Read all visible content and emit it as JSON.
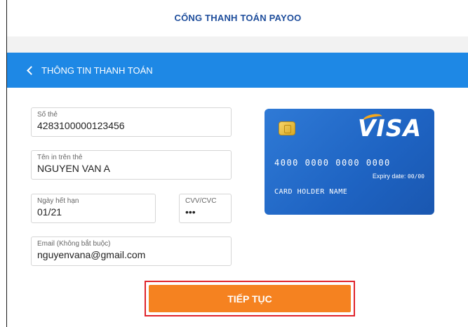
{
  "header": {
    "title": "CỔNG THANH TOÁN PAYOO"
  },
  "bar": {
    "back_label": "THÔNG TIN THANH TOÁN"
  },
  "form": {
    "card_number": {
      "label": "Số thẻ",
      "value": "4283100000123456"
    },
    "card_name": {
      "label": "Tên in trên thẻ",
      "value": "NGUYEN VAN A"
    },
    "expiry": {
      "label": "Ngày hết hạn",
      "value": "01/21"
    },
    "cvv": {
      "label": "CVV/CVC",
      "value": "•••"
    },
    "email": {
      "label": "Email (Không bắt buộc)",
      "value": "nguyenvana@gmail.com"
    }
  },
  "card_preview": {
    "brand": "VISA",
    "number": "4000 0000 0000 0000",
    "expiry_label": "Expiry date:",
    "expiry_value": "00/00",
    "holder": "CARD HOLDER NAME"
  },
  "actions": {
    "continue_label": "TIẾP TỤC"
  },
  "colors": {
    "header_text": "#1f4e9c",
    "bar": "#1e88e5",
    "button": "#f58220",
    "highlight": "#e0242b",
    "card": "#2f7ad6"
  }
}
